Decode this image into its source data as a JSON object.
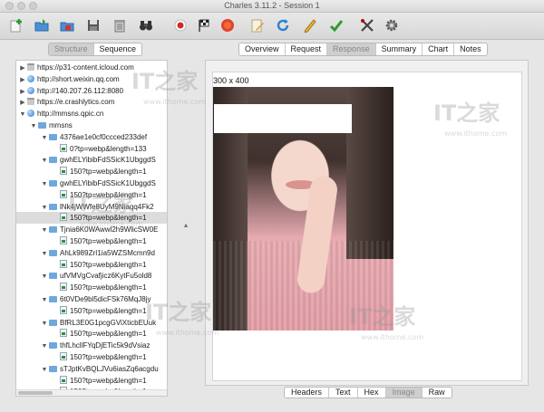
{
  "window": {
    "title": "Charles 3.11.2 - Session 1"
  },
  "toolbar": {
    "icons": [
      "new-session-icon",
      "open-icon",
      "import-icon",
      "save-icon",
      "trash-icon",
      "binoculars-icon",
      "record-icon",
      "throttle-flag-icon",
      "stop-icon",
      "compose-icon",
      "refresh-icon",
      "edit-icon",
      "validate-check-icon",
      "tools-icon",
      "settings-gear-icon"
    ]
  },
  "view_tabs": {
    "structure": "Structure",
    "sequence": "Sequence"
  },
  "detail_tabs": [
    "Overview",
    "Request",
    "Response",
    "Summary",
    "Chart",
    "Notes"
  ],
  "tree": [
    {
      "label": "https://p31-content.icloud.com",
      "level": 0,
      "icon": "lock",
      "expanded": false
    },
    {
      "label": "http://short.weixin.qq.com",
      "level": 0,
      "icon": "globe",
      "expanded": false
    },
    {
      "label": "http://140.207.26.112:8080",
      "level": 0,
      "icon": "globe",
      "expanded": false
    },
    {
      "label": "https://e.crashlytics.com",
      "level": 0,
      "icon": "lock",
      "expanded": false
    },
    {
      "label": "http://mmsns.qpic.cn",
      "level": 0,
      "icon": "globe",
      "expanded": true
    },
    {
      "label": "mmsns",
      "level": 1,
      "icon": "folder",
      "expanded": true
    },
    {
      "label": "4376ae1e0cf0ccced233def",
      "level": 2,
      "icon": "folder",
      "expanded": true
    },
    {
      "label": "0?tp=webp&length=133",
      "level": 3,
      "icon": "file"
    },
    {
      "label": "gwhELYibibFdSSicK1UbggdS",
      "level": 2,
      "icon": "folder",
      "expanded": true
    },
    {
      "label": "150?tp=webp&length=1",
      "level": 3,
      "icon": "file"
    },
    {
      "label": "gwhELYibibFdSSicK1UbggdS",
      "level": 2,
      "icon": "folder",
      "expanded": true
    },
    {
      "label": "150?tp=webp&length=1",
      "level": 3,
      "icon": "file"
    },
    {
      "label": "lNk4jWWfe8UyM9Niaqq4Fk2",
      "level": 2,
      "icon": "folder",
      "expanded": true
    },
    {
      "label": "150?tp=webp&length=1",
      "level": 3,
      "icon": "file",
      "selected": true
    },
    {
      "label": "Tjnia6K0WAwwl2h9WlicSW0E",
      "level": 2,
      "icon": "folder",
      "expanded": true
    },
    {
      "label": "150?tp=webp&length=1",
      "level": 3,
      "icon": "file"
    },
    {
      "label": "AhLk989ZrI1ia5WZSMcmn9d",
      "level": 2,
      "icon": "folder",
      "expanded": true
    },
    {
      "label": "150?tp=webp&length=1",
      "level": 3,
      "icon": "file"
    },
    {
      "label": "ufVMVgCvafjicz6KytFu5old8",
      "level": 2,
      "icon": "folder",
      "expanded": true
    },
    {
      "label": "150?tp=webp&length=1",
      "level": 3,
      "icon": "file"
    },
    {
      "label": "6t0VDe9bl5dicFSk76MqJ8jy",
      "level": 2,
      "icon": "folder",
      "expanded": true
    },
    {
      "label": "150?tp=webp&length=1",
      "level": 3,
      "icon": "file"
    },
    {
      "label": "BfRL3E0G1pcgGViXticbEUuk",
      "level": 2,
      "icon": "folder",
      "expanded": true
    },
    {
      "label": "150?tp=webp&length=1",
      "level": 3,
      "icon": "file"
    },
    {
      "label": "thfLhcllFYqDjETic5k9dVsiaz",
      "level": 2,
      "icon": "folder",
      "expanded": true
    },
    {
      "label": "150?tp=webp&length=1",
      "level": 3,
      "icon": "file"
    },
    {
      "label": "sTJptKvBQLJVu6iasZq6acgdu",
      "level": 2,
      "icon": "folder",
      "expanded": true
    },
    {
      "label": "150?tp=webp&length=1",
      "level": 3,
      "icon": "file"
    },
    {
      "label": "150?tp=webp&length=1",
      "level": 3,
      "icon": "file"
    }
  ],
  "image_view": {
    "dimensions_label": "300 x 400"
  },
  "bottom_tabs": [
    "Headers",
    "Text",
    "Hex",
    "Image",
    "Raw"
  ],
  "watermark": {
    "brand": "IT之家",
    "url": "www.ithome.com"
  }
}
